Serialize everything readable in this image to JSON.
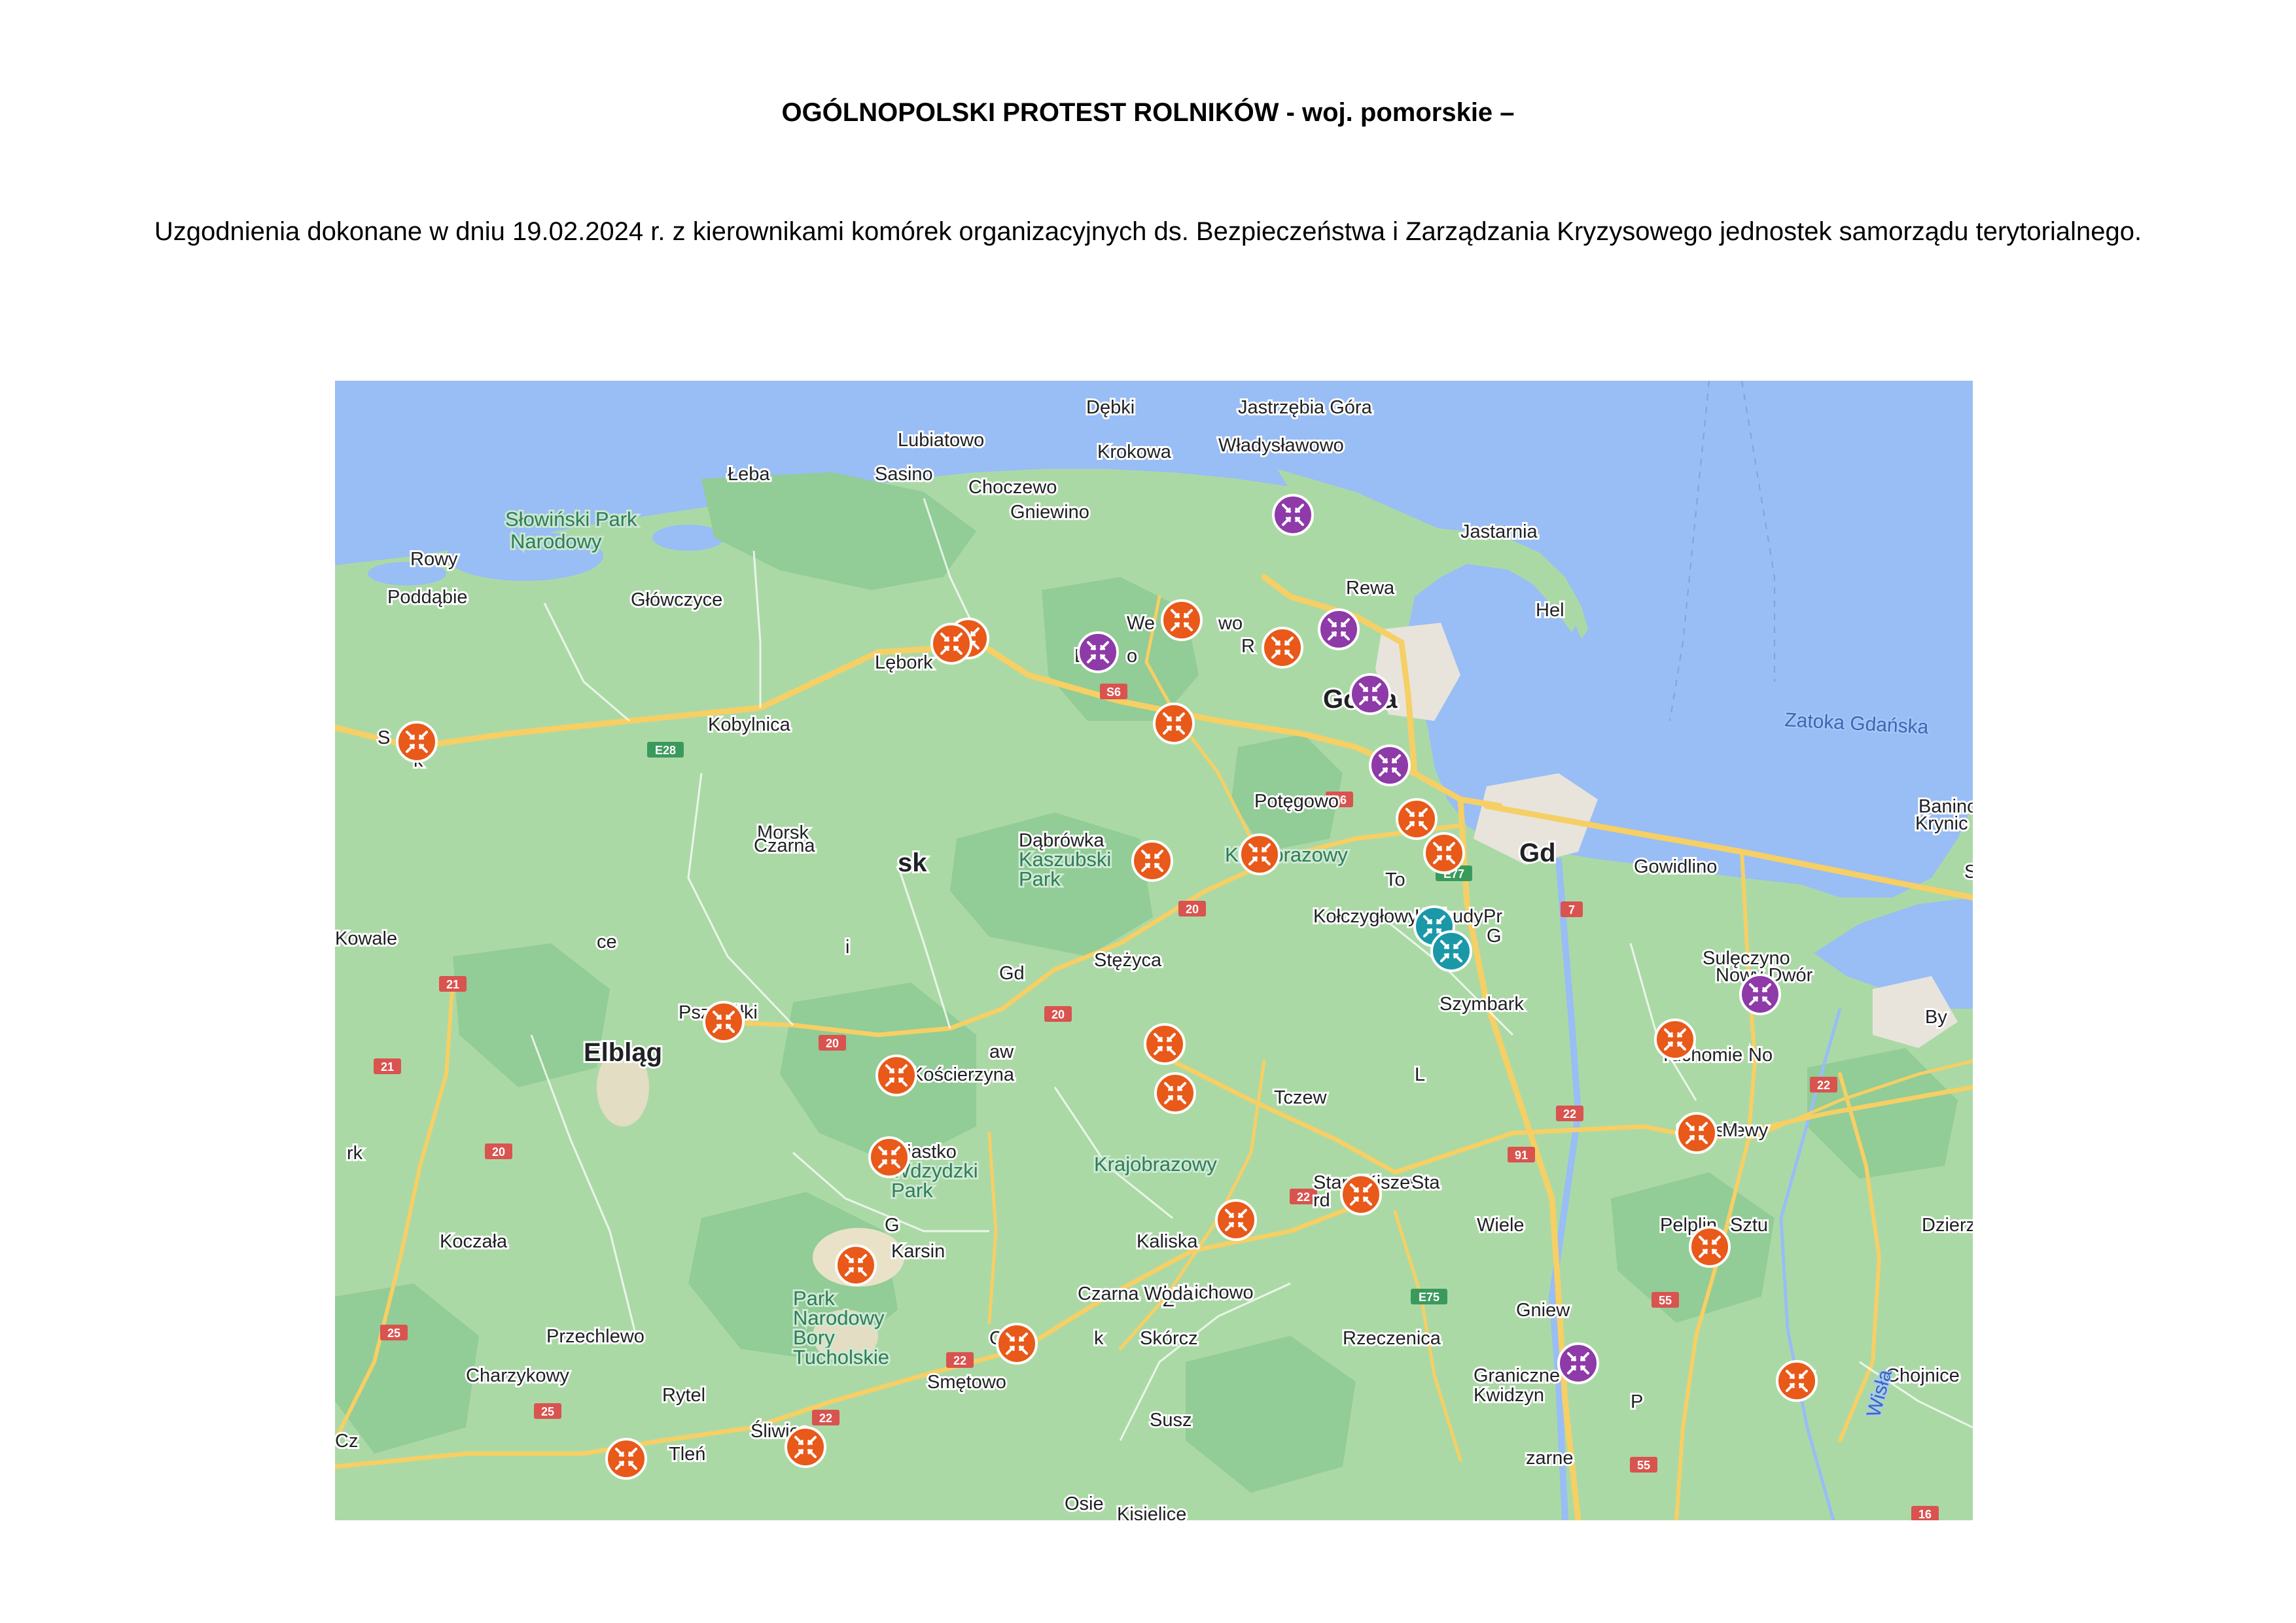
{
  "title": "OGÓLNOPOLSKI PROTEST ROLNIKÓW - woj. pomorskie –",
  "subtitle": "Uzgodnienia dokonane w dniu 19.02.2024 r.  z kierownikami komórek organizacyjnych  ds. Bezpieczeństwa i Zarządzania Kryzysowego jednostek samorządu terytorialnego.",
  "map": {
    "colors": {
      "sea": "#99bdf5",
      "land": "#abd9a6",
      "forest": "#92cc96",
      "road": "#f6cf65",
      "marker_orange": "#e8591a",
      "marker_purple": "#8e3aa8",
      "marker_teal": "#1b98a8"
    },
    "places": [
      {
        "text": "Dębki",
        "cls": "town"
      },
      {
        "text": "Jastrzębia Góra",
        "cls": "town"
      },
      {
        "text": "Lubiatowo",
        "cls": "town"
      },
      {
        "text": "Władysławowo",
        "cls": "town"
      },
      {
        "text": "Krokowa",
        "cls": "town"
      },
      {
        "text": "Łeba",
        "cls": "town"
      },
      {
        "text": "Sasino",
        "cls": "town"
      },
      {
        "text": "Choczewo",
        "cls": "town"
      },
      {
        "text": "Gniewino",
        "cls": "town"
      },
      {
        "text": "Słowiński Park",
        "cls": "sea-park"
      },
      {
        "text": "Narodowy",
        "cls": "sea-park"
      },
      {
        "text": "Jastarnia",
        "cls": "town"
      },
      {
        "text": "Rowy",
        "cls": "town"
      },
      {
        "text": "Poddąbie",
        "cls": "town"
      },
      {
        "text": "Główczyce",
        "cls": "town"
      },
      {
        "text": "Rewa",
        "cls": "town"
      },
      {
        "text": "Hel",
        "cls": "town"
      },
      {
        "text": "We",
        "cls": "town"
      },
      {
        "text": "wo",
        "cls": "town"
      },
      {
        "text": "R",
        "cls": "town"
      },
      {
        "text": "a",
        "cls": "town"
      },
      {
        "text": "L",
        "cls": "town"
      },
      {
        "text": "o",
        "cls": "town"
      },
      {
        "text": "Lębork",
        "cls": "town"
      },
      {
        "text": "Go",
        "cls": "city"
      },
      {
        "text": "ia",
        "cls": "city"
      },
      {
        "text": "Zatoka Gdańska",
        "cls": "water"
      },
      {
        "text": "S",
        "cls": "town"
      },
      {
        "text": "k",
        "cls": "town"
      },
      {
        "text": "Kobylnica",
        "cls": "town"
      },
      {
        "text": "Potęgowo",
        "cls": "town"
      },
      {
        "text": "Banino",
        "cls": "town"
      },
      {
        "text": "Krynic",
        "cls": "town"
      },
      {
        "text": "Morsk",
        "cls": "town"
      },
      {
        "text": "Czarna",
        "cls": "town"
      },
      {
        "text": "Dąbrówka",
        "cls": "town"
      },
      {
        "text": "Kaszubski",
        "cls": "park"
      },
      {
        "text": "Park",
        "cls": "park"
      },
      {
        "text": "Krajobrazowy",
        "cls": "park"
      },
      {
        "text": "Ż",
        "cls": "town"
      },
      {
        "text": "o",
        "cls": "town"
      },
      {
        "text": "Gd",
        "cls": "city"
      },
      {
        "text": "sk",
        "cls": "city"
      },
      {
        "text": "Gowidlino",
        "cls": "town"
      },
      {
        "text": "Stegna",
        "cls": "town"
      },
      {
        "text": "To",
        "cls": "town"
      },
      {
        "text": "Kowale",
        "cls": "town"
      },
      {
        "text": "ce",
        "cls": "town"
      },
      {
        "text": "Kołczygłowy",
        "cls": "town"
      },
      {
        "text": "Kolbudy",
        "cls": "town"
      },
      {
        "text": "Pr",
        "cls": "town"
      },
      {
        "text": "z",
        "cls": "town"
      },
      {
        "text": "G",
        "cls": "town"
      },
      {
        "text": "i",
        "cls": "town"
      },
      {
        "text": "Sulęczyno",
        "cls": "town"
      },
      {
        "text": "Nowy Dwór",
        "cls": "town"
      },
      {
        "text": "Gd",
        "cls": "town"
      },
      {
        "text": "Stężyca",
        "cls": "town"
      },
      {
        "text": "Szymbark",
        "cls": "town"
      },
      {
        "text": "Pszczółki",
        "cls": "town"
      },
      {
        "text": "By",
        "cls": "town"
      },
      {
        "text": "Elbląg",
        "cls": "city"
      },
      {
        "text": "Tuchomie",
        "cls": "town"
      },
      {
        "text": "No",
        "cls": "town"
      },
      {
        "text": "aw",
        "cls": "town"
      },
      {
        "text": "Kościerzyna",
        "cls": "town"
      },
      {
        "text": "L",
        "cls": "town"
      },
      {
        "text": "Tczew",
        "cls": "town"
      },
      {
        "text": "Skarszewy",
        "cls": "town"
      },
      {
        "text": "M",
        "cls": "town"
      },
      {
        "text": "rk",
        "cls": "town"
      },
      {
        "text": "Miastko",
        "cls": "town"
      },
      {
        "text": "Wdzydzki",
        "cls": "park"
      },
      {
        "text": "Park",
        "cls": "park"
      },
      {
        "text": "Krajobrazowy",
        "cls": "park"
      },
      {
        "text": "Stara Kiszewa",
        "cls": "town"
      },
      {
        "text": "Sta",
        "cls": "town"
      },
      {
        "text": "rd",
        "cls": "town"
      },
      {
        "text": "G",
        "cls": "town"
      },
      {
        "text": "Wiele",
        "cls": "town"
      },
      {
        "text": "Pelplin",
        "cls": "town"
      },
      {
        "text": "Sztu",
        "cls": "town"
      },
      {
        "text": "Dzierzgoń",
        "cls": "town"
      },
      {
        "text": "Koczała",
        "cls": "town"
      },
      {
        "text": "Karsin",
        "cls": "town"
      },
      {
        "text": "Kaliska",
        "cls": "town"
      },
      {
        "text": "Z",
        "cls": "town"
      },
      {
        "text": "Park",
        "cls": "park"
      },
      {
        "text": "Narodowy",
        "cls": "park"
      },
      {
        "text": "Bory",
        "cls": "park"
      },
      {
        "text": "Tucholskie",
        "cls": "park"
      },
      {
        "text": "Lubichowo",
        "cls": "town"
      },
      {
        "text": "Czarna Woda",
        "cls": "town"
      },
      {
        "text": "Gniew",
        "cls": "town"
      },
      {
        "text": "Przechlewo",
        "cls": "town"
      },
      {
        "text": "C",
        "cls": "town"
      },
      {
        "text": "k",
        "cls": "town"
      },
      {
        "text": "Skórcz",
        "cls": "town"
      },
      {
        "text": "Rzeczenica",
        "cls": "town"
      },
      {
        "text": "Charzykowy",
        "cls": "town"
      },
      {
        "text": "Rytel",
        "cls": "town"
      },
      {
        "text": "Smętowo",
        "cls": "town"
      },
      {
        "text": "Graniczne",
        "cls": "town"
      },
      {
        "text": "Kwidzyn",
        "cls": "town"
      },
      {
        "text": "P",
        "cls": "town"
      },
      {
        "text": "y",
        "cls": "town"
      },
      {
        "text": "Chojnice",
        "cls": "town"
      },
      {
        "text": "Śliwice",
        "cls": "town"
      },
      {
        "text": "Susz",
        "cls": "town"
      },
      {
        "text": "Wisła",
        "cls": "water"
      },
      {
        "text": "zarne",
        "cls": "town"
      },
      {
        "text": "Cz",
        "cls": "town"
      },
      {
        "text": "ów",
        "cls": "town"
      },
      {
        "text": "Tleń",
        "cls": "town"
      },
      {
        "text": "Osie",
        "cls": "town"
      },
      {
        "text": "Kisielice",
        "cls": "town"
      }
    ],
    "road_shields": [
      {
        "text": "E28"
      },
      {
        "text": "S6"
      },
      {
        "text": "S6"
      },
      {
        "text": "E77"
      },
      {
        "text": "7"
      },
      {
        "text": "20"
      },
      {
        "text": "20"
      },
      {
        "text": "20"
      },
      {
        "text": "21"
      },
      {
        "text": "21"
      },
      {
        "text": "20"
      },
      {
        "text": "22"
      },
      {
        "text": "22"
      },
      {
        "text": "91"
      },
      {
        "text": "22"
      },
      {
        "text": "E75"
      },
      {
        "text": "55"
      },
      {
        "text": "25"
      },
      {
        "text": "22"
      },
      {
        "text": "25"
      },
      {
        "text": "22"
      },
      {
        "text": "55"
      },
      {
        "text": "16"
      }
    ],
    "markers": {
      "orange": 26,
      "purple": 8,
      "teal": 2
    }
  }
}
